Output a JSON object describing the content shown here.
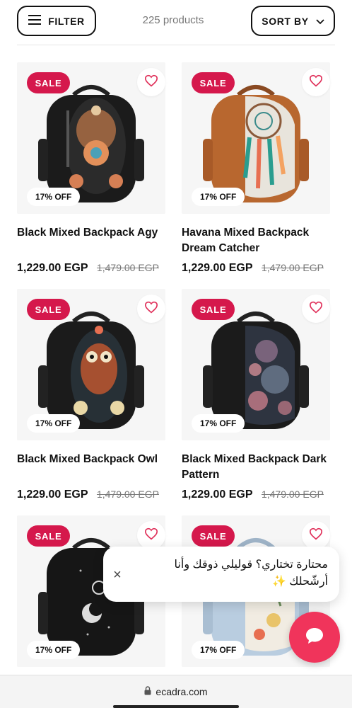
{
  "toolbar": {
    "filter_label": "FILTER",
    "sort_label": "SORT BY",
    "product_count": "225 products"
  },
  "products": [
    {
      "title": "Black Mixed Backpack Agy",
      "price": "1,229.00 EGP",
      "compare_price": "1,479.00 EGP",
      "sale": "SALE",
      "discount": "17% OFF"
    },
    {
      "title": "Havana Mixed Backpack Dream Catcher",
      "price": "1,229.00 EGP",
      "compare_price": "1,479.00 EGP",
      "sale": "SALE",
      "discount": "17% OFF"
    },
    {
      "title": "Black Mixed Backpack Owl",
      "price": "1,229.00 EGP",
      "compare_price": "1,479.00 EGP",
      "sale": "SALE",
      "discount": "17% OFF"
    },
    {
      "title": "Black Mixed Backpack Dark Pattern",
      "price": "1,229.00 EGP",
      "compare_price": "1,479.00 EGP",
      "sale": "SALE",
      "discount": "17% OFF"
    },
    {
      "sale": "SALE",
      "discount": "17% OFF"
    },
    {
      "sale": "SALE",
      "discount": "17% OFF"
    }
  ],
  "chat": {
    "message": "محتارة تختاري؟ قوليلي ذوقك وأنا أرشّحلك ✨",
    "close": "×"
  },
  "browser": {
    "url": "ecadra.com"
  },
  "colors": {
    "sale_badge": "#d5184c",
    "wishlist_heart": "#e0305a",
    "chat_button": "#f0345b"
  },
  "icons": [
    "menu-icon",
    "chevron-down-icon",
    "heart-icon",
    "chat-icon",
    "lock-icon",
    "close-icon"
  ]
}
